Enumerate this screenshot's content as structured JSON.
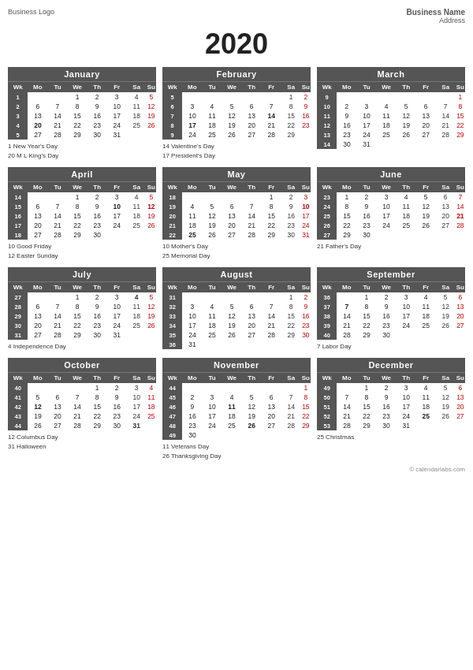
{
  "header": {
    "left": "Business Logo",
    "right_name": "Business Name",
    "right_address": "Address"
  },
  "year": "2020",
  "footer": "© calendarlabs.com",
  "months": [
    {
      "name": "January",
      "days_header": [
        "Wk",
        "Mo",
        "Tu",
        "We",
        "Th",
        "Fr",
        "Sa",
        "Su"
      ],
      "weeks": [
        [
          1,
          "",
          "",
          "1",
          "2",
          "3",
          "4",
          "5"
        ],
        [
          2,
          "6",
          "7",
          "8",
          "9",
          "10",
          "11",
          "12"
        ],
        [
          3,
          "13",
          "14",
          "15",
          "16",
          "17",
          "18",
          "19"
        ],
        [
          4,
          "20",
          "21",
          "22",
          "23",
          "24",
          "25",
          "26"
        ],
        [
          5,
          "27",
          "28",
          "29",
          "30",
          "31",
          "",
          ""
        ]
      ],
      "bold_days": [
        "20"
      ],
      "holidays": [
        "1  New Year's Day",
        "20  M L King's Day"
      ]
    },
    {
      "name": "February",
      "days_header": [
        "Wk",
        "Mo",
        "Tu",
        "We",
        "Th",
        "Fr",
        "Sa",
        "Su"
      ],
      "weeks": [
        [
          5,
          "",
          "",
          "",
          "",
          "",
          "1",
          "2"
        ],
        [
          6,
          "3",
          "4",
          "5",
          "6",
          "7",
          "8",
          "9"
        ],
        [
          7,
          "10",
          "11",
          "12",
          "13",
          "14",
          "15",
          "16"
        ],
        [
          8,
          "17",
          "18",
          "19",
          "20",
          "21",
          "22",
          "23"
        ],
        [
          9,
          "24",
          "25",
          "26",
          "27",
          "28",
          "29",
          ""
        ]
      ],
      "bold_days": [
        "14",
        "17"
      ],
      "holidays": [
        "14  Valentine's Day",
        "17  President's Day"
      ]
    },
    {
      "name": "March",
      "days_header": [
        "Wk",
        "Mo",
        "Tu",
        "We",
        "Th",
        "Fr",
        "Sa",
        "Su"
      ],
      "weeks": [
        [
          9,
          "",
          "",
          "",
          "",
          "",
          "",
          "1"
        ],
        [
          10,
          "2",
          "3",
          "4",
          "5",
          "6",
          "7",
          "8"
        ],
        [
          11,
          "9",
          "10",
          "11",
          "12",
          "13",
          "14",
          "15"
        ],
        [
          12,
          "16",
          "17",
          "18",
          "19",
          "20",
          "21",
          "22"
        ],
        [
          13,
          "23",
          "24",
          "25",
          "26",
          "27",
          "28",
          "29"
        ],
        [
          14,
          "30",
          "31",
          "",
          "",
          "",
          "",
          ""
        ]
      ],
      "bold_days": [],
      "holidays": []
    },
    {
      "name": "April",
      "days_header": [
        "Wk",
        "Mo",
        "Tu",
        "We",
        "Th",
        "Fr",
        "Sa",
        "Su"
      ],
      "weeks": [
        [
          14,
          "",
          "",
          "1",
          "2",
          "3",
          "4",
          "5"
        ],
        [
          15,
          "6",
          "7",
          "8",
          "9",
          "10",
          "11",
          "12"
        ],
        [
          16,
          "13",
          "14",
          "15",
          "16",
          "17",
          "18",
          "19"
        ],
        [
          17,
          "20",
          "21",
          "22",
          "23",
          "24",
          "25",
          "26"
        ],
        [
          18,
          "27",
          "28",
          "29",
          "30",
          "",
          "",
          ""
        ]
      ],
      "bold_days": [
        "10",
        "12"
      ],
      "holidays": [
        "10  Good Friday",
        "12  Easter Sunday"
      ]
    },
    {
      "name": "May",
      "days_header": [
        "Wk",
        "Mo",
        "Tu",
        "We",
        "Th",
        "Fr",
        "Sa",
        "Su"
      ],
      "weeks": [
        [
          18,
          "",
          "",
          "",
          "",
          "1",
          "2",
          "3"
        ],
        [
          19,
          "4",
          "5",
          "6",
          "7",
          "8",
          "9",
          "10"
        ],
        [
          20,
          "11",
          "12",
          "13",
          "14",
          "15",
          "16",
          "17"
        ],
        [
          21,
          "18",
          "19",
          "20",
          "21",
          "22",
          "23",
          "24"
        ],
        [
          22,
          "25",
          "26",
          "27",
          "28",
          "29",
          "30",
          "31"
        ]
      ],
      "bold_days": [
        "10",
        "25"
      ],
      "holidays": [
        "10  Mother's Day",
        "25  Memorial Day"
      ]
    },
    {
      "name": "June",
      "days_header": [
        "Wk",
        "Mo",
        "Tu",
        "We",
        "Th",
        "Fr",
        "Sa",
        "Su"
      ],
      "weeks": [
        [
          23,
          "1",
          "2",
          "3",
          "4",
          "5",
          "6",
          "7"
        ],
        [
          24,
          "8",
          "9",
          "10",
          "11",
          "12",
          "13",
          "14"
        ],
        [
          25,
          "15",
          "16",
          "17",
          "18",
          "19",
          "20",
          "21"
        ],
        [
          26,
          "22",
          "23",
          "24",
          "25",
          "26",
          "27",
          "28"
        ],
        [
          27,
          "29",
          "30",
          "",
          "",
          "",
          "",
          ""
        ]
      ],
      "bold_days": [
        "21"
      ],
      "holidays": [
        "21  Father's Day"
      ]
    },
    {
      "name": "July",
      "days_header": [
        "Wk",
        "Mo",
        "Tu",
        "We",
        "Th",
        "Fr",
        "Sa",
        "Su"
      ],
      "weeks": [
        [
          27,
          "",
          "",
          "1",
          "2",
          "3",
          "4",
          "5"
        ],
        [
          28,
          "6",
          "7",
          "8",
          "9",
          "10",
          "11",
          "12"
        ],
        [
          29,
          "13",
          "14",
          "15",
          "16",
          "17",
          "18",
          "19"
        ],
        [
          30,
          "20",
          "21",
          "22",
          "23",
          "24",
          "25",
          "26"
        ],
        [
          31,
          "27",
          "28",
          "29",
          "30",
          "31",
          "",
          ""
        ]
      ],
      "bold_days": [
        "4"
      ],
      "holidays": [
        "4  Independence Day"
      ]
    },
    {
      "name": "August",
      "days_header": [
        "Wk",
        "Mo",
        "Tu",
        "We",
        "Th",
        "Fr",
        "Sa",
        "Su"
      ],
      "weeks": [
        [
          31,
          "",
          "",
          "",
          "",
          "",
          "1",
          "2"
        ],
        [
          32,
          "3",
          "4",
          "5",
          "6",
          "7",
          "8",
          "9"
        ],
        [
          33,
          "10",
          "11",
          "12",
          "13",
          "14",
          "15",
          "16"
        ],
        [
          34,
          "17",
          "18",
          "19",
          "20",
          "21",
          "22",
          "23"
        ],
        [
          35,
          "24",
          "25",
          "26",
          "27",
          "28",
          "29",
          "30"
        ],
        [
          36,
          "31",
          "",
          "",
          "",
          "",
          "",
          ""
        ]
      ],
      "bold_days": [],
      "holidays": []
    },
    {
      "name": "September",
      "days_header": [
        "Wk",
        "Mo",
        "Tu",
        "We",
        "Th",
        "Fr",
        "Sa",
        "Su"
      ],
      "weeks": [
        [
          36,
          "",
          "1",
          "2",
          "3",
          "4",
          "5",
          "6"
        ],
        [
          37,
          "7",
          "8",
          "9",
          "10",
          "11",
          "12",
          "13"
        ],
        [
          38,
          "14",
          "15",
          "16",
          "17",
          "18",
          "19",
          "20"
        ],
        [
          39,
          "21",
          "22",
          "23",
          "24",
          "25",
          "26",
          "27"
        ],
        [
          40,
          "28",
          "29",
          "30",
          "",
          "",
          "",
          ""
        ]
      ],
      "bold_days": [
        "7"
      ],
      "holidays": [
        "7  Labor Day"
      ]
    },
    {
      "name": "October",
      "days_header": [
        "Wk",
        "Mo",
        "Tu",
        "We",
        "Th",
        "Fr",
        "Sa",
        "Su"
      ],
      "weeks": [
        [
          40,
          "",
          "",
          "",
          "1",
          "2",
          "3",
          "4"
        ],
        [
          41,
          "5",
          "6",
          "7",
          "8",
          "9",
          "10",
          "11"
        ],
        [
          42,
          "12",
          "13",
          "14",
          "15",
          "16",
          "17",
          "18"
        ],
        [
          43,
          "19",
          "20",
          "21",
          "22",
          "23",
          "24",
          "25"
        ],
        [
          44,
          "26",
          "27",
          "28",
          "29",
          "30",
          "31",
          ""
        ]
      ],
      "bold_days": [
        "12",
        "31"
      ],
      "holidays": [
        "12  Columbus Day",
        "31  Halloween"
      ]
    },
    {
      "name": "November",
      "days_header": [
        "Wk",
        "Mo",
        "Tu",
        "We",
        "Th",
        "Fr",
        "Sa",
        "Su"
      ],
      "weeks": [
        [
          44,
          "",
          "",
          "",
          "",
          "",
          "",
          "1"
        ],
        [
          45,
          "2",
          "3",
          "4",
          "5",
          "6",
          "7",
          "8"
        ],
        [
          46,
          "9",
          "10",
          "11",
          "12",
          "13",
          "14",
          "15"
        ],
        [
          47,
          "16",
          "17",
          "18",
          "19",
          "20",
          "21",
          "22"
        ],
        [
          48,
          "23",
          "24",
          "25",
          "26",
          "27",
          "28",
          "29"
        ],
        [
          49,
          "30",
          "",
          "",
          "",
          "",
          "",
          ""
        ]
      ],
      "bold_days": [
        "11",
        "26"
      ],
      "holidays": [
        "11  Veterans Day",
        "26  Thanksgiving Day"
      ]
    },
    {
      "name": "December",
      "days_header": [
        "Wk",
        "Mo",
        "Tu",
        "We",
        "Th",
        "Fr",
        "Sa",
        "Su"
      ],
      "weeks": [
        [
          49,
          "",
          "1",
          "2",
          "3",
          "4",
          "5",
          "6"
        ],
        [
          50,
          "7",
          "8",
          "9",
          "10",
          "11",
          "12",
          "13"
        ],
        [
          51,
          "14",
          "15",
          "16",
          "17",
          "18",
          "19",
          "20"
        ],
        [
          52,
          "21",
          "22",
          "23",
          "24",
          "25",
          "26",
          "27"
        ],
        [
          53,
          "28",
          "29",
          "30",
          "31",
          "",
          "",
          ""
        ]
      ],
      "bold_days": [
        "25"
      ],
      "holidays": [
        "25  Christmas"
      ]
    }
  ]
}
